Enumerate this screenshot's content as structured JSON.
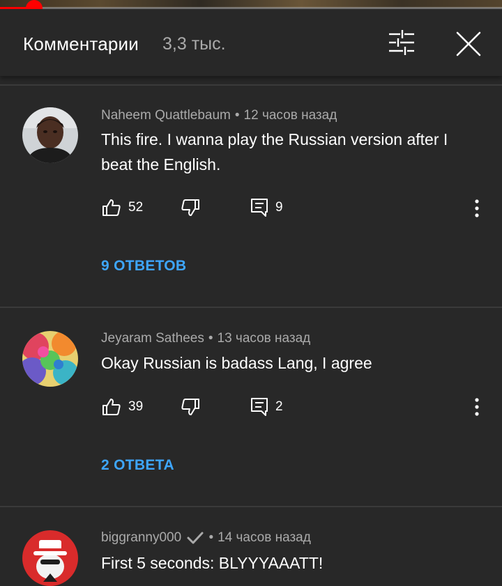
{
  "player": {
    "progress_fraction": 0.068
  },
  "header": {
    "title": "Комментарии",
    "count": "3,3 тыс.",
    "sort_icon": "sort-sliders-icon",
    "close_icon": "close-x-icon"
  },
  "comments": [
    {
      "author": "Naheem Quattlebaum",
      "time": "12 часов назад",
      "text": "This fire. I wanna play the Russian version after I beat the English.",
      "likes": "52",
      "reply_count": "9",
      "replies_link": "9 ОТВЕТОВ",
      "verified": false
    },
    {
      "author": "Jeyaram Sathees",
      "time": "13 часов назад",
      "text": "Okay Russian is badass Lang, I agree",
      "likes": "39",
      "reply_count": "2",
      "replies_link": "2 ОТВЕТА",
      "verified": false
    },
    {
      "author": "biggranny000",
      "time": "14 часов назад",
      "text": "First 5 seconds: BLYYYAAATT!",
      "verified": true
    }
  ],
  "separator": "•",
  "colors": {
    "background": "#282828",
    "accent_link": "#3ea6ff",
    "progress": "#ff0000",
    "secondary_text": "#aaaaaa"
  }
}
